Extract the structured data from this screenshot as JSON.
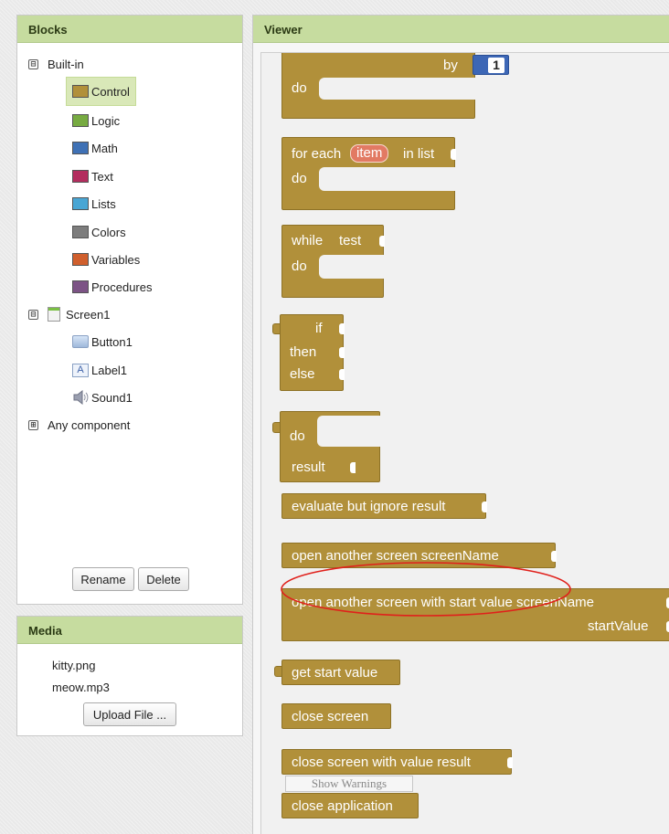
{
  "blocks_panel": {
    "title": "Blocks",
    "builtin_label": "Built-in",
    "builtin_items": [
      {
        "label": "Control",
        "color": "#b1903a",
        "selected": true
      },
      {
        "label": "Logic",
        "color": "#77ab41"
      },
      {
        "label": "Math",
        "color": "#3f71b5"
      },
      {
        "label": "Text",
        "color": "#b32d5e"
      },
      {
        "label": "Lists",
        "color": "#49a6d4"
      },
      {
        "label": "Colors",
        "color": "#7d7d7d"
      },
      {
        "label": "Variables",
        "color": "#d05f2d"
      },
      {
        "label": "Procedures",
        "color": "#7c5385"
      }
    ],
    "screen_label": "Screen1",
    "screen_components": [
      {
        "label": "Button1",
        "icon": "button-component-icon"
      },
      {
        "label": "Label1",
        "icon": "label-component-icon"
      },
      {
        "label": "Sound1",
        "icon": "speaker-icon"
      }
    ],
    "any_component_label": "Any component",
    "collapse_symbol": "⊟",
    "expand_symbol": "⊞",
    "rename_label": "Rename",
    "delete_label": "Delete"
  },
  "media_panel": {
    "title": "Media",
    "files": [
      "kitty.png",
      "meow.mp3"
    ],
    "upload_label": "Upload File ..."
  },
  "viewer": {
    "title": "Viewer",
    "show_warnings_label": "Show Warnings",
    "highlight_color": "#e0201b",
    "blocks": {
      "for_range": {
        "by": "by",
        "do": "do",
        "value": "1"
      },
      "for_each": {
        "prefix": "for each",
        "item": "item",
        "suffix": "in list",
        "do": "do"
      },
      "while": {
        "label": "while",
        "test": "test",
        "do": "do"
      },
      "if_expr": {
        "if": "if",
        "then": "then",
        "else": "else"
      },
      "do_result": {
        "do": "do",
        "result": "result"
      },
      "evaluate": "evaluate but ignore result",
      "open_screen": "open another screen  screenName",
      "open_screen_start": {
        "line1": "open another screen with start value  screenName",
        "line2": "startValue"
      },
      "get_start_value": "get start value",
      "close_screen": "close screen",
      "close_screen_value": "close screen with value  result",
      "close_application": "close application"
    }
  }
}
